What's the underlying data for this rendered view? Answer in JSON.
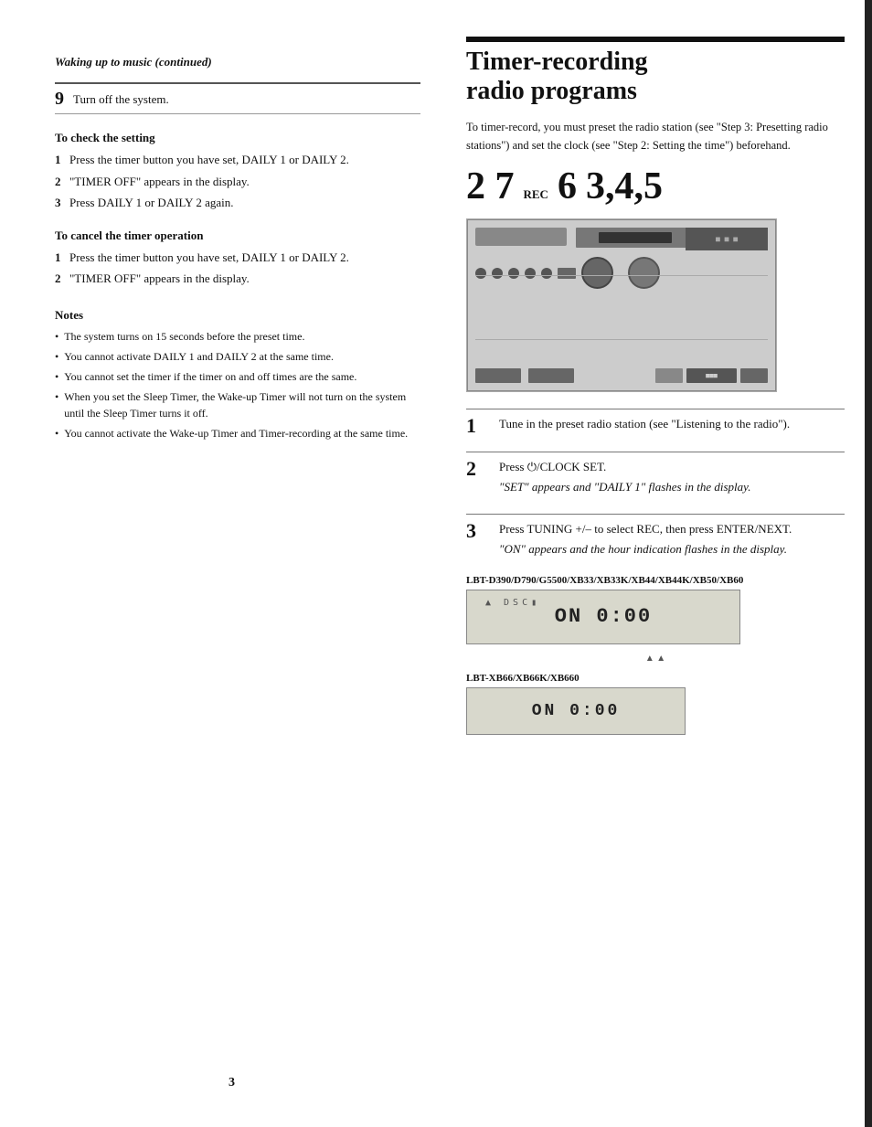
{
  "left": {
    "section_title": "Waking up to music (continued)",
    "step9": {
      "number": "9",
      "text": "Turn off the system."
    },
    "check_setting": {
      "heading": "To check the setting",
      "steps": [
        {
          "num": "1",
          "text": "Press the timer button you have set, DAILY 1 or DAILY 2."
        },
        {
          "num": "2",
          "text": "\"TIMER OFF\" appears in the display."
        },
        {
          "num": "3",
          "text": "Press DAILY 1 or DAILY 2 again."
        }
      ]
    },
    "cancel_timer": {
      "heading": "To cancel the timer operation",
      "steps": [
        {
          "num": "1",
          "text": "Press the timer button you have set, DAILY 1 or DAILY 2."
        },
        {
          "num": "2",
          "text": "\"TIMER OFF\" appears in the display."
        }
      ]
    },
    "notes": {
      "heading": "Notes",
      "items": [
        "The system turns on 15 seconds before the preset time.",
        "You cannot activate DAILY 1 and DAILY 2 at the same time.",
        "You cannot set the timer if the timer on and off times are the same.",
        "When you set the Sleep Timer, the Wake-up Timer will not turn on the system until the Sleep Timer turns it off.",
        "You cannot activate the Wake-up Timer and Timer-recording at the same time."
      ]
    },
    "page_number": "3"
  },
  "right": {
    "heading_line1": "Timer-recording",
    "heading_line2": "radio programs",
    "intro": "To timer-record, you must preset the radio station (see \"Step 3: Presetting radio stations\") and set the clock (see \"Step 2: Setting the time\") beforehand.",
    "device_numbers": {
      "num1": "2 7",
      "sub1": "REC",
      "num2": "6",
      "num3": "3,4,5"
    },
    "steps": [
      {
        "num": "1",
        "main": "Tune in the preset radio station (see \"Listening to the radio\")."
      },
      {
        "num": "2",
        "main": "Press ⏻/CLOCK SET.",
        "detail": "\"SET\" appears and \"DAILY 1\" flashes in the display."
      },
      {
        "num": "3",
        "main": "Press TUNING +/– to select REC, then press ENTER/NEXT.",
        "detail": "\"ON\" appears and the hour indication flashes in the display."
      }
    ],
    "model_label1": "LBT-D390/D790/G5500/XB33/XB33K/XB44/XB44K/XB50/XB60",
    "display1": "ON   0:00",
    "display1_arrows": "▲        ▲",
    "model_label2": "LBT-XB66/XB66K/XB660",
    "display2": "ON  0:00"
  }
}
